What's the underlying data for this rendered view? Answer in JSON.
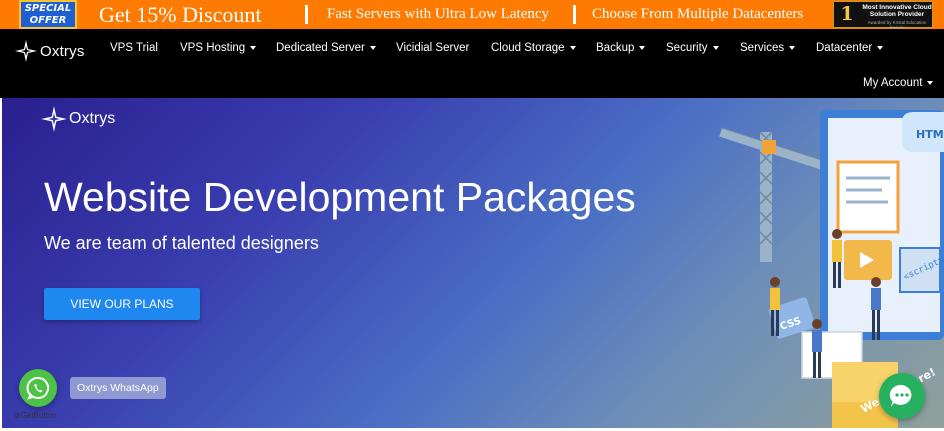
{
  "promo": {
    "special_line1": "SPECIAL",
    "special_line2": "OFFER",
    "discount": "Get 15% Discount",
    "fast_servers": "Fast Servers with Ultra Low Latency",
    "datacenters": "Choose From Multiple Datacenters",
    "award": {
      "number": "1",
      "title": "Most Innovative Cloud Solution Provider",
      "by": "Awarded by Kristal Education Society"
    },
    "colors": {
      "banner": "#ff7a00",
      "special_bg": "#1f5fd1"
    }
  },
  "nav": {
    "logo_text": "Oxtrys",
    "items": [
      {
        "label": "VPS Trial",
        "dropdown": false
      },
      {
        "label": "VPS Hosting",
        "dropdown": true
      },
      {
        "label": "Dedicated Server",
        "dropdown": true
      },
      {
        "label": "Vicidial Server",
        "dropdown": false
      },
      {
        "label": "Cloud Storage",
        "dropdown": true
      },
      {
        "label": "Backup",
        "dropdown": true
      },
      {
        "label": "Security",
        "dropdown": true
      },
      {
        "label": "Services",
        "dropdown": true
      },
      {
        "label": "Datacenter",
        "dropdown": true
      }
    ],
    "account_label": "My Account"
  },
  "hero": {
    "logo_text": "Oxtrys",
    "title": "Website Development Packages",
    "subtitle": "We are team of talented designers",
    "cta_label": "VIEW OUR PLANS",
    "illustration": {
      "html_sign": "HTM",
      "script_tag": "<script>",
      "css_tag": "CSS",
      "badge": "We Are Here!"
    },
    "colors": {
      "cta": "#1e88f0"
    }
  },
  "whatsapp": {
    "label": "Oxtrys WhatsApp",
    "powered_by": "GetButton",
    "color": "#4dc247"
  },
  "chat": {
    "color": "#27b05f"
  }
}
